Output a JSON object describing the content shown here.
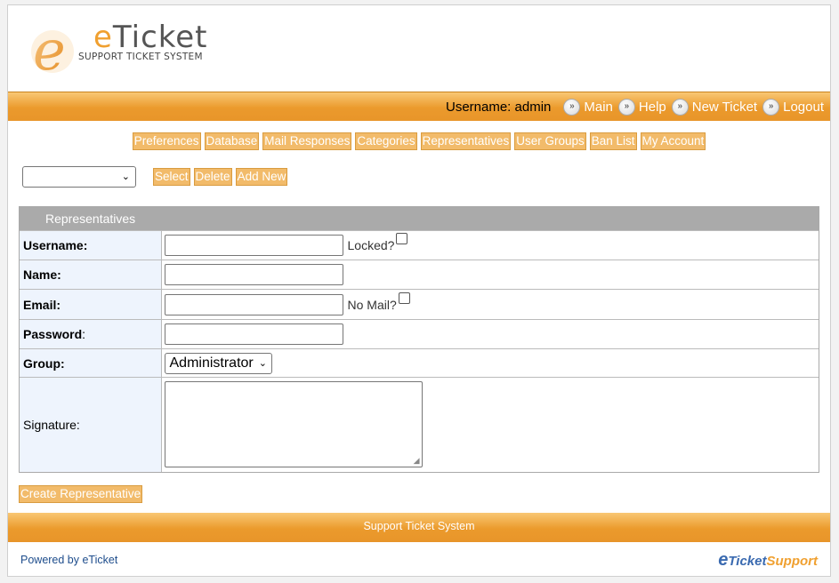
{
  "logo": {
    "letter": "e",
    "title_e": "e",
    "title_rest": "Ticket",
    "subtitle": "SUPPORT TICKET SYSTEM"
  },
  "navbar": {
    "username": "Username: admin",
    "links": [
      {
        "label": "Main",
        "icon": "double-chevron-icon"
      },
      {
        "label": "Help",
        "icon": "double-chevron-icon"
      },
      {
        "label": "New Ticket",
        "icon": "double-chevron-icon"
      },
      {
        "label": "Logout",
        "icon": "double-chevron-icon"
      }
    ]
  },
  "tabs": [
    "Preferences",
    "Database",
    "Mail Responses",
    "Categories",
    "Representatives",
    "User Groups",
    "Ban List",
    "My Account"
  ],
  "selector": {
    "value": "",
    "buttons": [
      "Select",
      "Delete",
      "Add New"
    ]
  },
  "form": {
    "heading": "Representatives",
    "username": {
      "label": "Username:",
      "value": "",
      "extra": "Locked?"
    },
    "name": {
      "label": "Name:",
      "value": ""
    },
    "email": {
      "label": "Email:",
      "value": "",
      "extra": "No Mail?"
    },
    "password": {
      "label": "Password",
      "suffix": ":",
      "value": ""
    },
    "group": {
      "label": "Group:",
      "value": "Administrator"
    },
    "signature": {
      "label": "Signature:",
      "value": ""
    },
    "submit": "Create Representative"
  },
  "footer": {
    "bar": "Support Ticket System",
    "powered": "Powered by eTicket",
    "logo_e": "e",
    "logo_ticket": "Ticket",
    "logo_support": "Support"
  },
  "colors": {
    "accent": "#eb9a2c",
    "button": "#f2bb6a",
    "label_bg": "#eef4fd",
    "panel_head": "#aaaaaa"
  }
}
